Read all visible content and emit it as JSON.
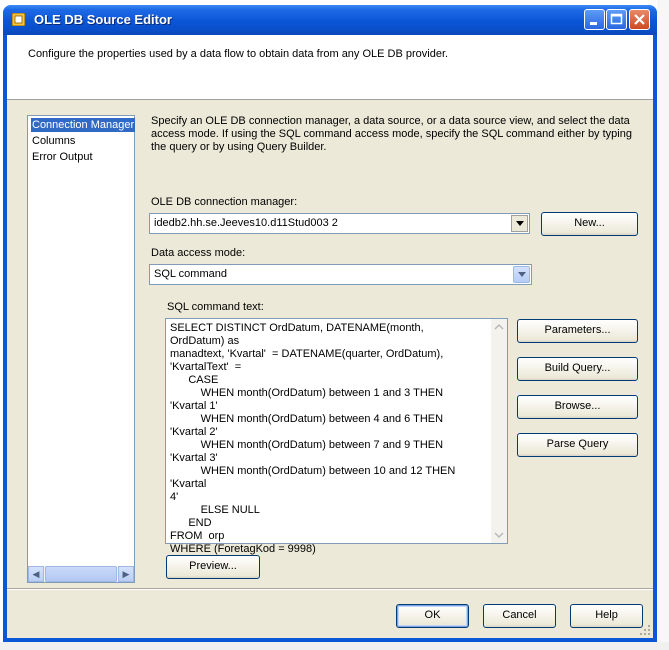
{
  "window": {
    "title": "OLE DB Source Editor",
    "header_description": "Configure the properties used by a data flow to obtain data from any OLE DB provider."
  },
  "nav": {
    "items": [
      {
        "label": "Connection Manager",
        "selected": true
      },
      {
        "label": "Columns",
        "selected": false
      },
      {
        "label": "Error Output",
        "selected": false
      }
    ]
  },
  "content": {
    "instructions": "Specify an OLE DB connection manager, a data source, or a data source view, and select the data access mode. If using the SQL command access mode, specify the SQL command either by typing the query or by using Query Builder.",
    "connection_label": "OLE DB connection manager:",
    "connection_value": "idedb2.hh.se.Jeeves10.d11Stud003 2",
    "new_button": "New...",
    "access_mode_label": "Data access mode:",
    "access_mode_value": "SQL command",
    "sql_label": "SQL command text:",
    "sql_text": "SELECT DISTINCT OrdDatum, DATENAME(month, OrdDatum) as\nmanadtext, 'Kvartal'  = DATENAME(quarter, OrdDatum),\n'KvartalText'  =\n      CASE\n          WHEN month(OrdDatum) between 1 and 3 THEN 'Kvartal 1'\n          WHEN month(OrdDatum) between 4 and 6 THEN 'Kvartal 2'\n          WHEN month(OrdDatum) between 7 and 9 THEN 'Kvartal 3'\n          WHEN month(OrdDatum) between 10 and 12 THEN 'Kvartal\n4'\n          ELSE NULL\n      END\nFROM  orp\nWHERE (ForetagKod = 9998)",
    "parameters_button": "Parameters...",
    "build_query_button": "Build Query...",
    "browse_button": "Browse...",
    "parse_query_button": "Parse Query",
    "preview_button": "Preview..."
  },
  "footer": {
    "ok_button": "OK",
    "cancel_button": "Cancel",
    "help_button": "Help"
  },
  "colors": {
    "title_bar": "#0a55d6",
    "dialog_bg": "#ece9d8",
    "selection": "#316ac5"
  }
}
